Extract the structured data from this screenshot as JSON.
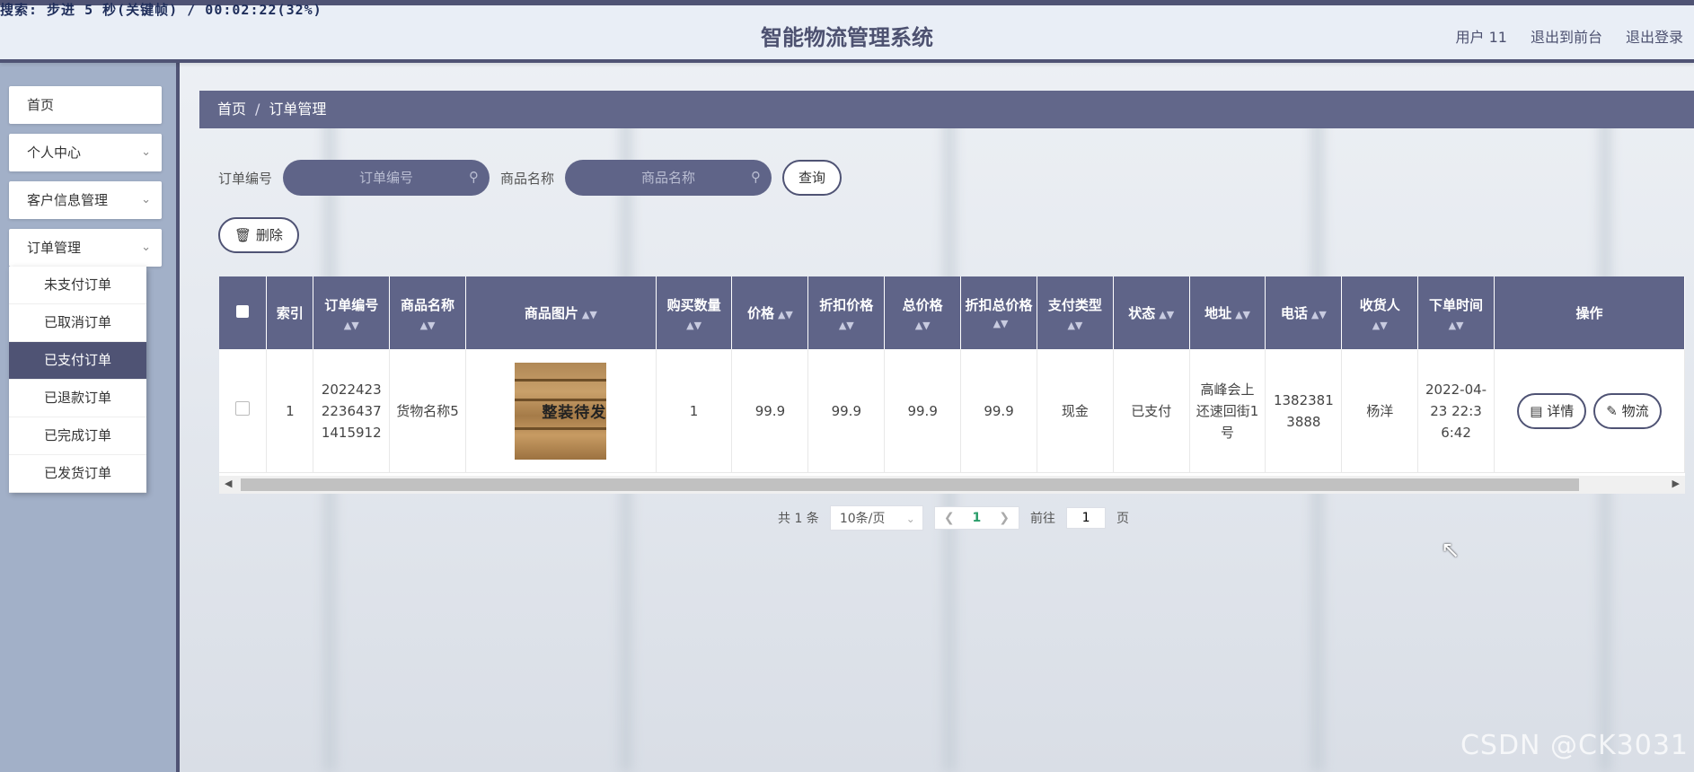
{
  "overlay": {
    "text": "搜索: 步进 5 秒(关键帧) / 00:02:22(32%)"
  },
  "header": {
    "title": "智能物流管理系统",
    "user": "用户 11",
    "back_to_front": "退出到前台",
    "logout": "退出登录"
  },
  "sidebar": {
    "items": [
      {
        "label": "首页",
        "has_chevron": false
      },
      {
        "label": "个人中心",
        "has_chevron": true
      },
      {
        "label": "客户信息管理",
        "has_chevron": true
      },
      {
        "label": "订单管理",
        "has_chevron": true
      }
    ],
    "submenu": [
      {
        "label": "未支付订单",
        "active": false
      },
      {
        "label": "已取消订单",
        "active": false
      },
      {
        "label": "已支付订单",
        "active": true
      },
      {
        "label": "已退款订单",
        "active": false
      },
      {
        "label": "已完成订单",
        "active": false
      },
      {
        "label": "已发货订单",
        "active": false
      }
    ]
  },
  "breadcrumb": {
    "home": "首页",
    "current": "订单管理"
  },
  "search": {
    "order_no_label": "订单编号",
    "order_no_placeholder": "订单编号",
    "product_label": "商品名称",
    "product_placeholder": "商品名称",
    "query_button": "查询"
  },
  "toolbar": {
    "delete_label": "删除"
  },
  "table": {
    "headers": {
      "index": "索引",
      "order_no": "订单编号",
      "product_name": "商品名称",
      "product_image": "商品图片",
      "quantity": "购买数量",
      "price": "价格",
      "discount_price": "折扣价格",
      "total_price": "总价格",
      "discount_total": "折扣总价格",
      "payment_type": "支付类型",
      "status": "状态",
      "address": "地址",
      "phone": "电话",
      "receiver": "收货人",
      "order_time": "下单时间",
      "actions": "操作"
    },
    "rows": [
      {
        "index": "1",
        "order_no": "20224232236437 1415912",
        "product_name": "货物名称5",
        "image_stamp": "整装待发",
        "quantity": "1",
        "price": "99.9",
        "discount_price": "99.9",
        "total_price": "99.9",
        "discount_total": "99.9",
        "payment_type": "现金",
        "status": "已支付",
        "address": "高峰会上还速回街1号",
        "phone": "13823813888",
        "receiver": "杨洋",
        "order_time": "2022-04-23 22:36:42",
        "detail_button": "详情",
        "logistics_button": "物流"
      }
    ]
  },
  "pagination": {
    "total": "共 1 条",
    "page_size": "10条/页",
    "current_page": "1",
    "goto_label": "前往",
    "goto_value": "1",
    "page_suffix": "页"
  },
  "watermark": "CSDN @CK3031"
}
